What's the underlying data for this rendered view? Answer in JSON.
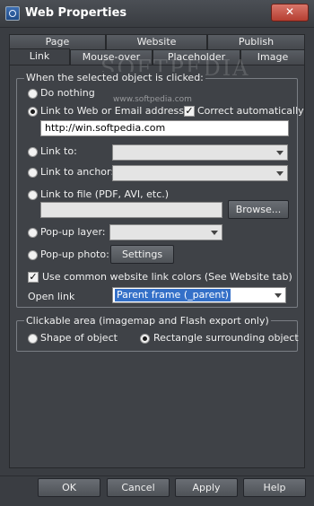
{
  "window": {
    "title": "Web Properties",
    "close_glyph": "✕"
  },
  "tabs_back": [
    "Page",
    "Website",
    "Publish"
  ],
  "tabs_front": [
    "Link",
    "Mouse-over",
    "Placeholder",
    "Image"
  ],
  "watermark": {
    "big": "SOFTPEDIA",
    "small": "www.softpedia.com"
  },
  "link_group": {
    "legend": "When the selected object is clicked:",
    "do_nothing": "Do nothing",
    "link_web": "Link to Web or Email address:",
    "correct_automatically": "Correct automatically",
    "url_value": "http://win.softpedia.com",
    "link_to": "Link to:",
    "link_anchor": "Link to anchor:",
    "link_file": "Link to file (PDF, AVI, etc.)",
    "browse_label": "Browse...",
    "popup_layer": "Pop-up layer:",
    "popup_photo": "Pop-up photo:",
    "settings_label": "Settings",
    "common_colors": "Use common website link colors (See Website tab)",
    "open_link_label": "Open link",
    "open_link_value": "Parent frame (_parent)"
  },
  "clickable_group": {
    "legend": "Clickable area (imagemap and Flash export only)",
    "shape": "Shape of object",
    "rectangle": "Rectangle surrounding object"
  },
  "buttons": {
    "ok": "OK",
    "cancel": "Cancel",
    "apply": "Apply",
    "help": "Help"
  }
}
